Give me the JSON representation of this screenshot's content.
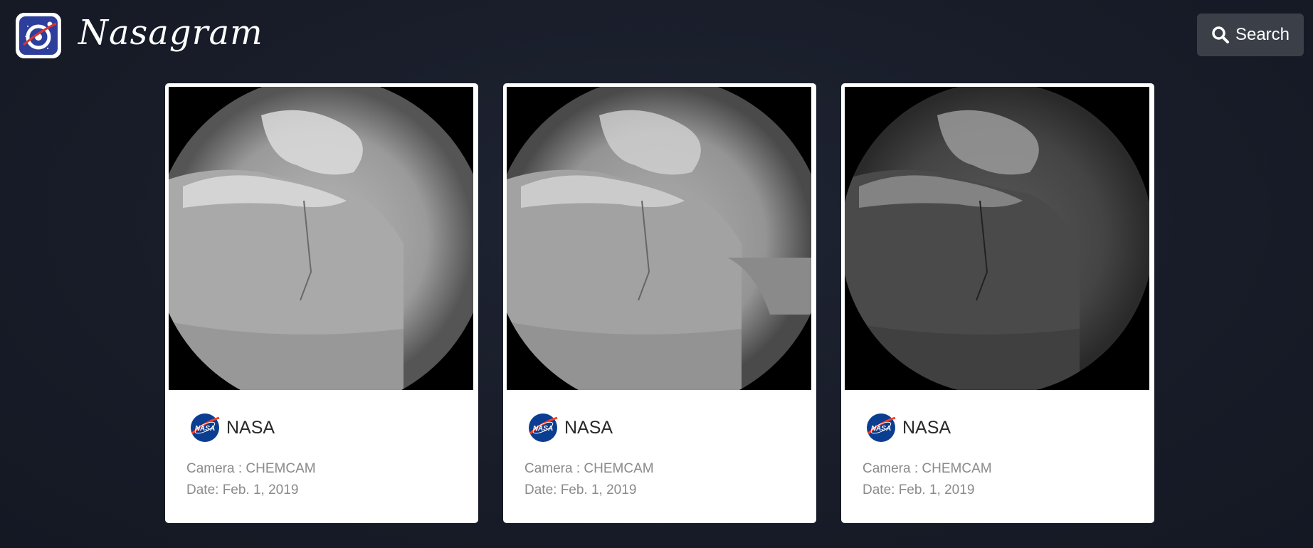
{
  "app": {
    "brand": "Nasagram",
    "logo_icon": "nasagram-camera-logo-icon"
  },
  "toolbar": {
    "search_label": "Search",
    "search_icon": "search-icon"
  },
  "posts": [
    {
      "author": "NASA",
      "avatar_icon": "nasa-meatball-logo-icon",
      "camera": "Camera : CHEMCAM",
      "date": "Date: Feb. 1, 2019",
      "image_tone": "light"
    },
    {
      "author": "NASA",
      "avatar_icon": "nasa-meatball-logo-icon",
      "camera": "Camera : CHEMCAM",
      "date": "Date: Feb. 1, 2019",
      "image_tone": "light"
    },
    {
      "author": "NASA",
      "avatar_icon": "nasa-meatball-logo-icon",
      "camera": "Camera : CHEMCAM",
      "date": "Date: Feb. 1, 2019",
      "image_tone": "dark"
    }
  ],
  "colors": {
    "background": "#181c28",
    "card": "#ffffff",
    "button": "#3a3f48",
    "nasa_blue": "#0b3d91",
    "nasa_red": "#fc3d21"
  }
}
